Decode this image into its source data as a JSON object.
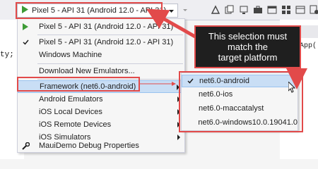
{
  "colors": {
    "accent_red": "#e24a4a",
    "highlight": "#c9def5",
    "play_green": "#3d9b36",
    "callout_bg": "#1f1f1f"
  },
  "editor": {
    "left_code": "ty;",
    "right_code": "App("
  },
  "toolbar": {
    "target_label": "Pixel 5 - API 31 (Android 12.0 - API 31)"
  },
  "menu": {
    "items": [
      {
        "label": "Pixel 5 - API 31 (Android 12.0 - API 31)",
        "icon": "play-icon"
      },
      {
        "label": "Pixel 5 - API 31 (Android 12.0 - API 31)",
        "icon": "check-icon"
      },
      {
        "label": "Windows Machine"
      },
      {
        "label": "Download New Emulators..."
      },
      {
        "label": "Framework (net6.0-android)"
      },
      {
        "label": "Android Emulators"
      },
      {
        "label": "iOS Local Devices"
      },
      {
        "label": "iOS Remote Devices"
      },
      {
        "label": "iOS Simulators"
      },
      {
        "label": "MauiDemo Debug Properties",
        "icon": "wrench-icon"
      }
    ]
  },
  "submenu": {
    "items": [
      {
        "label": "net6.0-android",
        "checked": true
      },
      {
        "label": "net6.0-ios"
      },
      {
        "label": "net6.0-maccatalyst"
      },
      {
        "label": "net6.0-windows10.0.19041.0"
      }
    ]
  },
  "callout": {
    "line1": "This selection must",
    "line2": "match the",
    "line3": "target platform"
  }
}
